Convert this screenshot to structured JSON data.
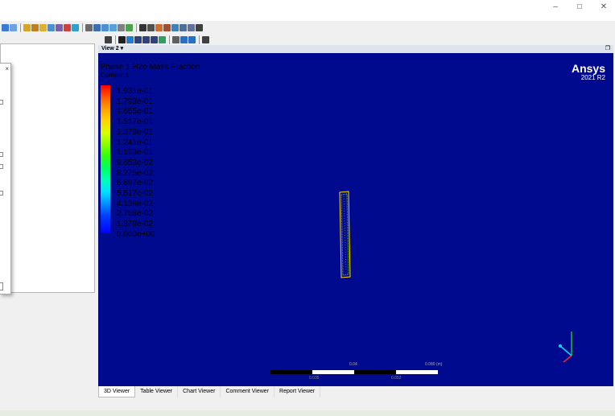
{
  "window": {
    "minimize_glyph": "–",
    "maximize_glyph": "□",
    "close_glyph": "✕"
  },
  "dialog": {
    "close_glyph": "×"
  },
  "view": {
    "title": "View 2 ▾",
    "maximize_glyph": "❐"
  },
  "brand": {
    "name": "Ansys",
    "version": "2021 R2"
  },
  "legend": {
    "title": "Phase 1.H2o Mass Fraction",
    "subtitle": "Contour 1",
    "labels": [
      "1.931e-01",
      "1.793e-01",
      "1.655e-01",
      "1.517e-01",
      "1.379e-01",
      "1.241e-01",
      "1.103e-01",
      "9.653e-02",
      "8.275e-02",
      "6.897e-02",
      "5.517e-02",
      "4.138e-02",
      "2.758e-02",
      "1.379e-02",
      "0.000e+00"
    ]
  },
  "scale": {
    "label_left": "0.035",
    "label_right": "0.052",
    "label_top_mid": "0.04",
    "label_top_end": "0.080 (m)"
  },
  "tabs": [
    {
      "label": "3D Viewer",
      "active": true
    },
    {
      "label": "Table Viewer",
      "active": false
    },
    {
      "label": "Chart Viewer",
      "active": false
    },
    {
      "label": "Comment Viewer",
      "active": false
    },
    {
      "label": "Report Viewer",
      "active": false
    }
  ],
  "colors": {
    "viewport_bg": "#000a8e",
    "contour_outline": "#ffdd00",
    "axis_x": "#ff2020",
    "axis_y": "#20c020",
    "axis_z": "#00d8ff"
  }
}
